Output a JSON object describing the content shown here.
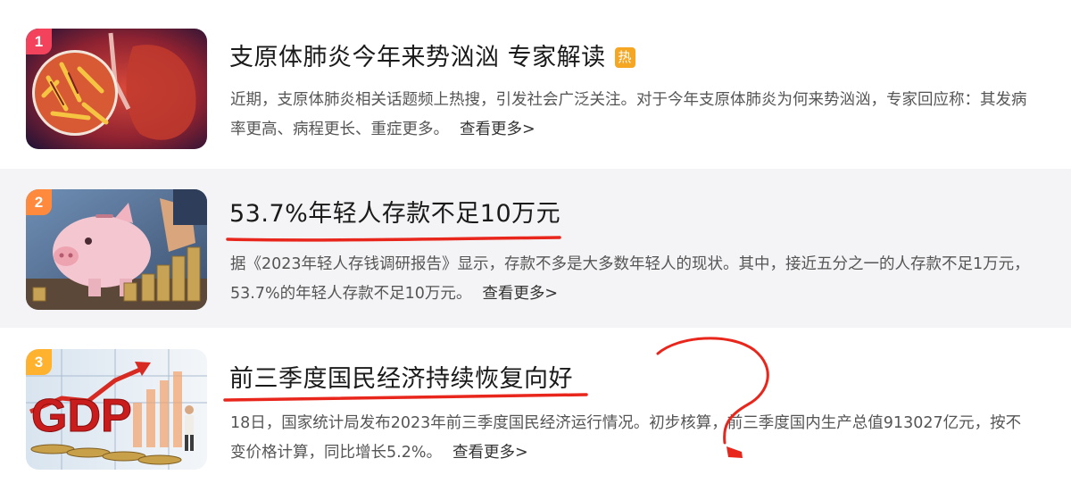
{
  "colors": {
    "rank_1": "#f2425c",
    "rank_2": "#ff8a3d",
    "rank_3": "#ffb22e",
    "hot_badge": "#f5a623",
    "annotation": "#e8261c"
  },
  "news": [
    {
      "rank": "1",
      "title": "支原体肺炎今年来势汹汹 专家解读",
      "badge": "热",
      "desc": "近期，支原体肺炎相关话题频上热搜，引发社会广泛关注。对于今年支原体肺炎为何来势汹汹，专家回应称：其发病率更高、病程更长、重症更多。",
      "more": "查看更多>",
      "image_icon": "lung-bacteria-image"
    },
    {
      "rank": "2",
      "title": "53.7%年轻人存款不足10万元",
      "desc": "据《2023年轻人存钱调研报告》显示，存款不多是大多数年轻人的现状。其中，接近五分之一的人存款不足1万元，53.7%的年轻人存款不足10万元。",
      "more": "查看更多>",
      "image_icon": "piggy-bank-image"
    },
    {
      "rank": "3",
      "title": "前三季度国民经济持续恢复向好",
      "desc": "18日，国家统计局发布2023年前三季度国民经济运行情况。初步核算，前三季度国内生产总值913027亿元，按不变价格计算，同比增长5.2%。",
      "more": "查看更多>",
      "image_icon": "gdp-chart-image"
    }
  ]
}
